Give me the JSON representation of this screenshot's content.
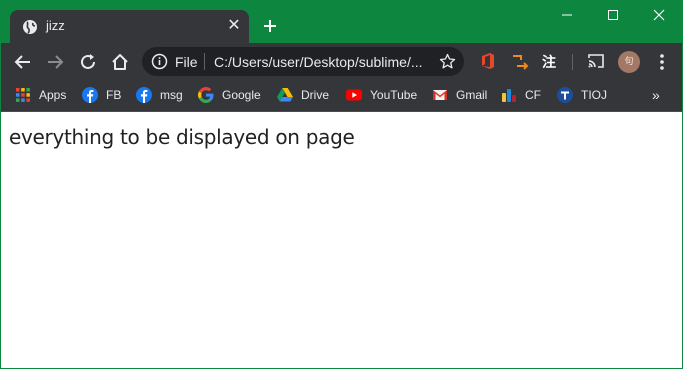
{
  "tab": {
    "title": "jizz",
    "close_glyph": "✕"
  },
  "new_tab_glyph": "+",
  "omnibox": {
    "scheme_label": "File",
    "url": "C:/Users/user/Desktop/sublime/..."
  },
  "extension_zh": "注",
  "avatar_text": "句",
  "bookmarks": [
    {
      "label": "Apps",
      "icon": "apps-grid-icon"
    },
    {
      "label": "FB",
      "icon": "facebook-icon"
    },
    {
      "label": "msg",
      "icon": "facebook-icon"
    },
    {
      "label": "Google",
      "icon": "google-icon"
    },
    {
      "label": "Drive",
      "icon": "drive-icon"
    },
    {
      "label": "YouTube",
      "icon": "youtube-icon"
    },
    {
      "label": "Gmail",
      "icon": "gmail-icon"
    },
    {
      "label": "CF",
      "icon": "codeforces-icon"
    },
    {
      "label": "TIOJ",
      "icon": "tioj-icon"
    }
  ],
  "bookmarks_more": "»",
  "page": {
    "text": "everything to be displayed on page"
  },
  "colors": {
    "frame": "#0d863f",
    "toolbar": "#35363a",
    "omnibox": "#202124"
  }
}
